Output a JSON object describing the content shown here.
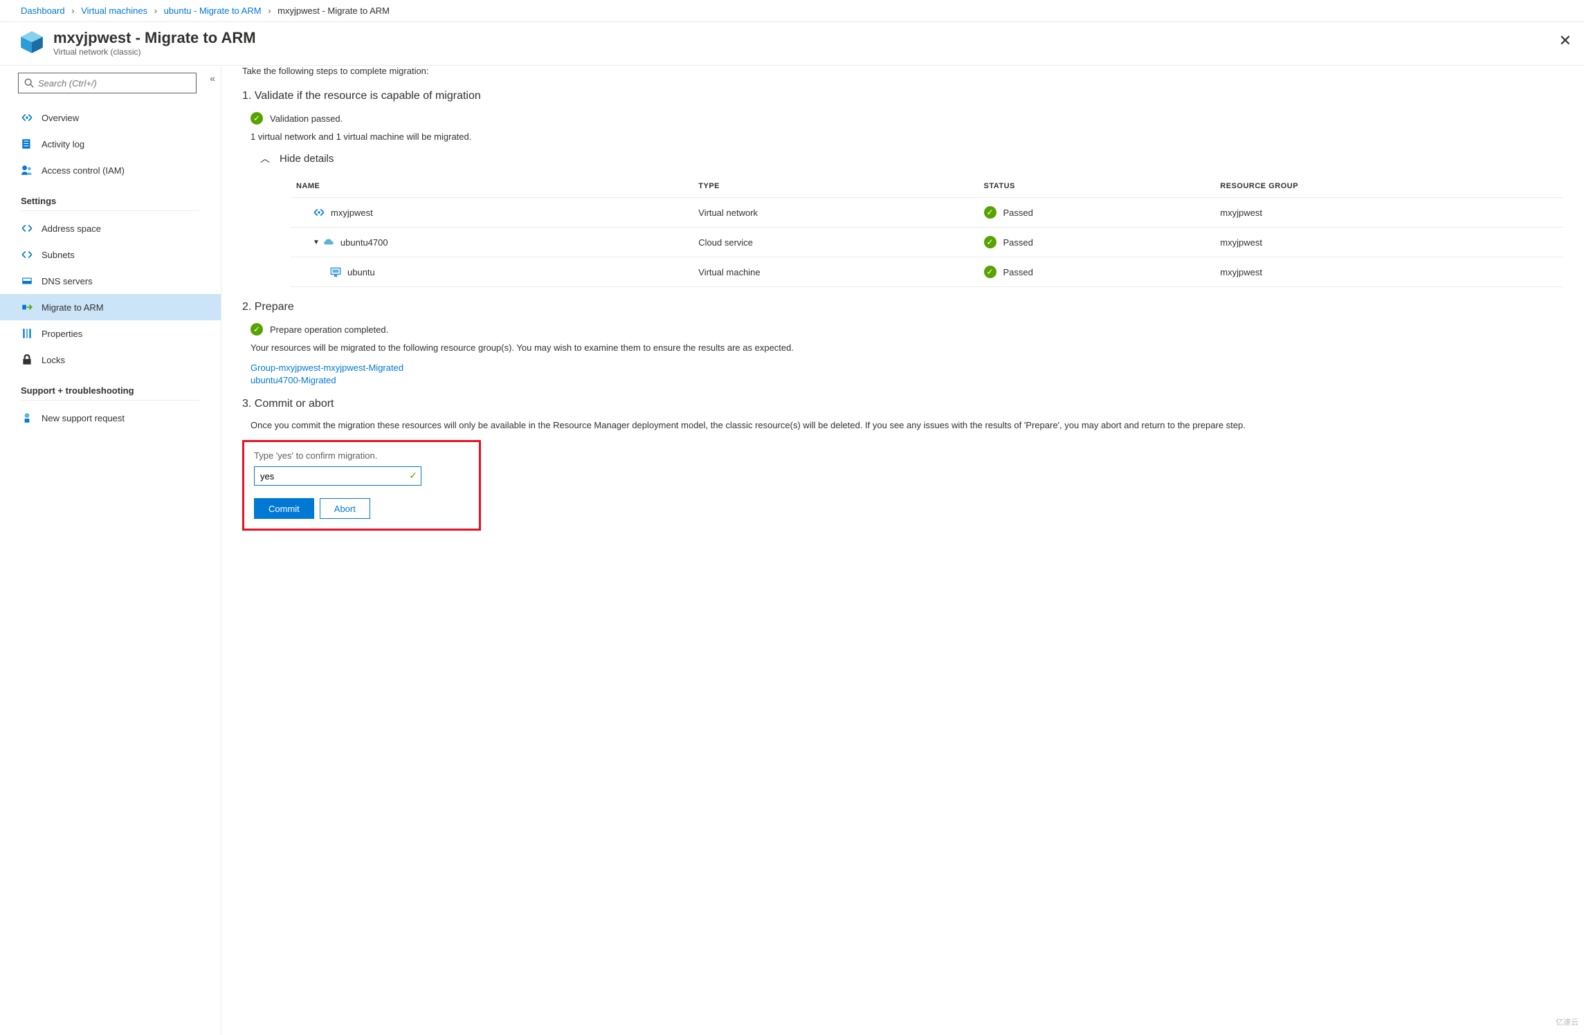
{
  "breadcrumb": {
    "items": [
      "Dashboard",
      "Virtual machines",
      "ubuntu - Migrate to ARM"
    ],
    "current": "mxyjpwest - Migrate to ARM"
  },
  "header": {
    "title": "mxyjpwest - Migrate to ARM",
    "subtitle": "Virtual network (classic)"
  },
  "sidebar": {
    "search_placeholder": "Search (Ctrl+/)",
    "items": {
      "overview": "Overview",
      "activity": "Activity log",
      "iam": "Access control (IAM)"
    },
    "section_settings": "Settings",
    "settings": {
      "address": "Address space",
      "subnets": "Subnets",
      "dns": "DNS servers",
      "migrate": "Migrate to ARM",
      "properties": "Properties",
      "locks": "Locks"
    },
    "section_support": "Support + troubleshooting",
    "support": {
      "new_request": "New support request"
    }
  },
  "content": {
    "intro": "Take the following steps to complete migration:",
    "step1": {
      "title": "1. Validate if the resource is capable of migration",
      "status": "Validation passed.",
      "summary": "1 virtual network and 1 virtual machine will be migrated.",
      "toggle": "Hide details",
      "table": {
        "headers": {
          "name": "NAME",
          "type": "TYPE",
          "status": "STATUS",
          "rg": "RESOURCE GROUP"
        },
        "rows": [
          {
            "name": "mxyjpwest",
            "type": "Virtual network",
            "status": "Passed",
            "rg": "mxyjpwest",
            "icon": "vnet",
            "indent": 0
          },
          {
            "name": "ubuntu4700",
            "type": "Cloud service",
            "status": "Passed",
            "rg": "mxyjpwest",
            "icon": "cloud",
            "indent": 1,
            "expandable": true
          },
          {
            "name": "ubuntu",
            "type": "Virtual machine",
            "status": "Passed",
            "rg": "mxyjpwest",
            "icon": "vm",
            "indent": 2
          }
        ]
      }
    },
    "step2": {
      "title": "2. Prepare",
      "status": "Prepare operation completed.",
      "body": "Your resources will be migrated to the following resource group(s). You may wish to examine them to ensure the results are as expected.",
      "links": [
        "Group-mxyjpwest-mxyjpwest-Migrated",
        "ubuntu4700-Migrated"
      ]
    },
    "step3": {
      "title": "3. Commit or abort",
      "body": "Once you commit the migration these resources will only be available in the Resource Manager deployment model, the classic resource(s) will be deleted. If you see any issues with the results of 'Prepare', you may abort and return to the prepare step.",
      "confirm_label": "Type 'yes' to confirm migration.",
      "confirm_value": "yes",
      "commit_label": "Commit",
      "abort_label": "Abort"
    }
  },
  "watermark": "亿速云"
}
